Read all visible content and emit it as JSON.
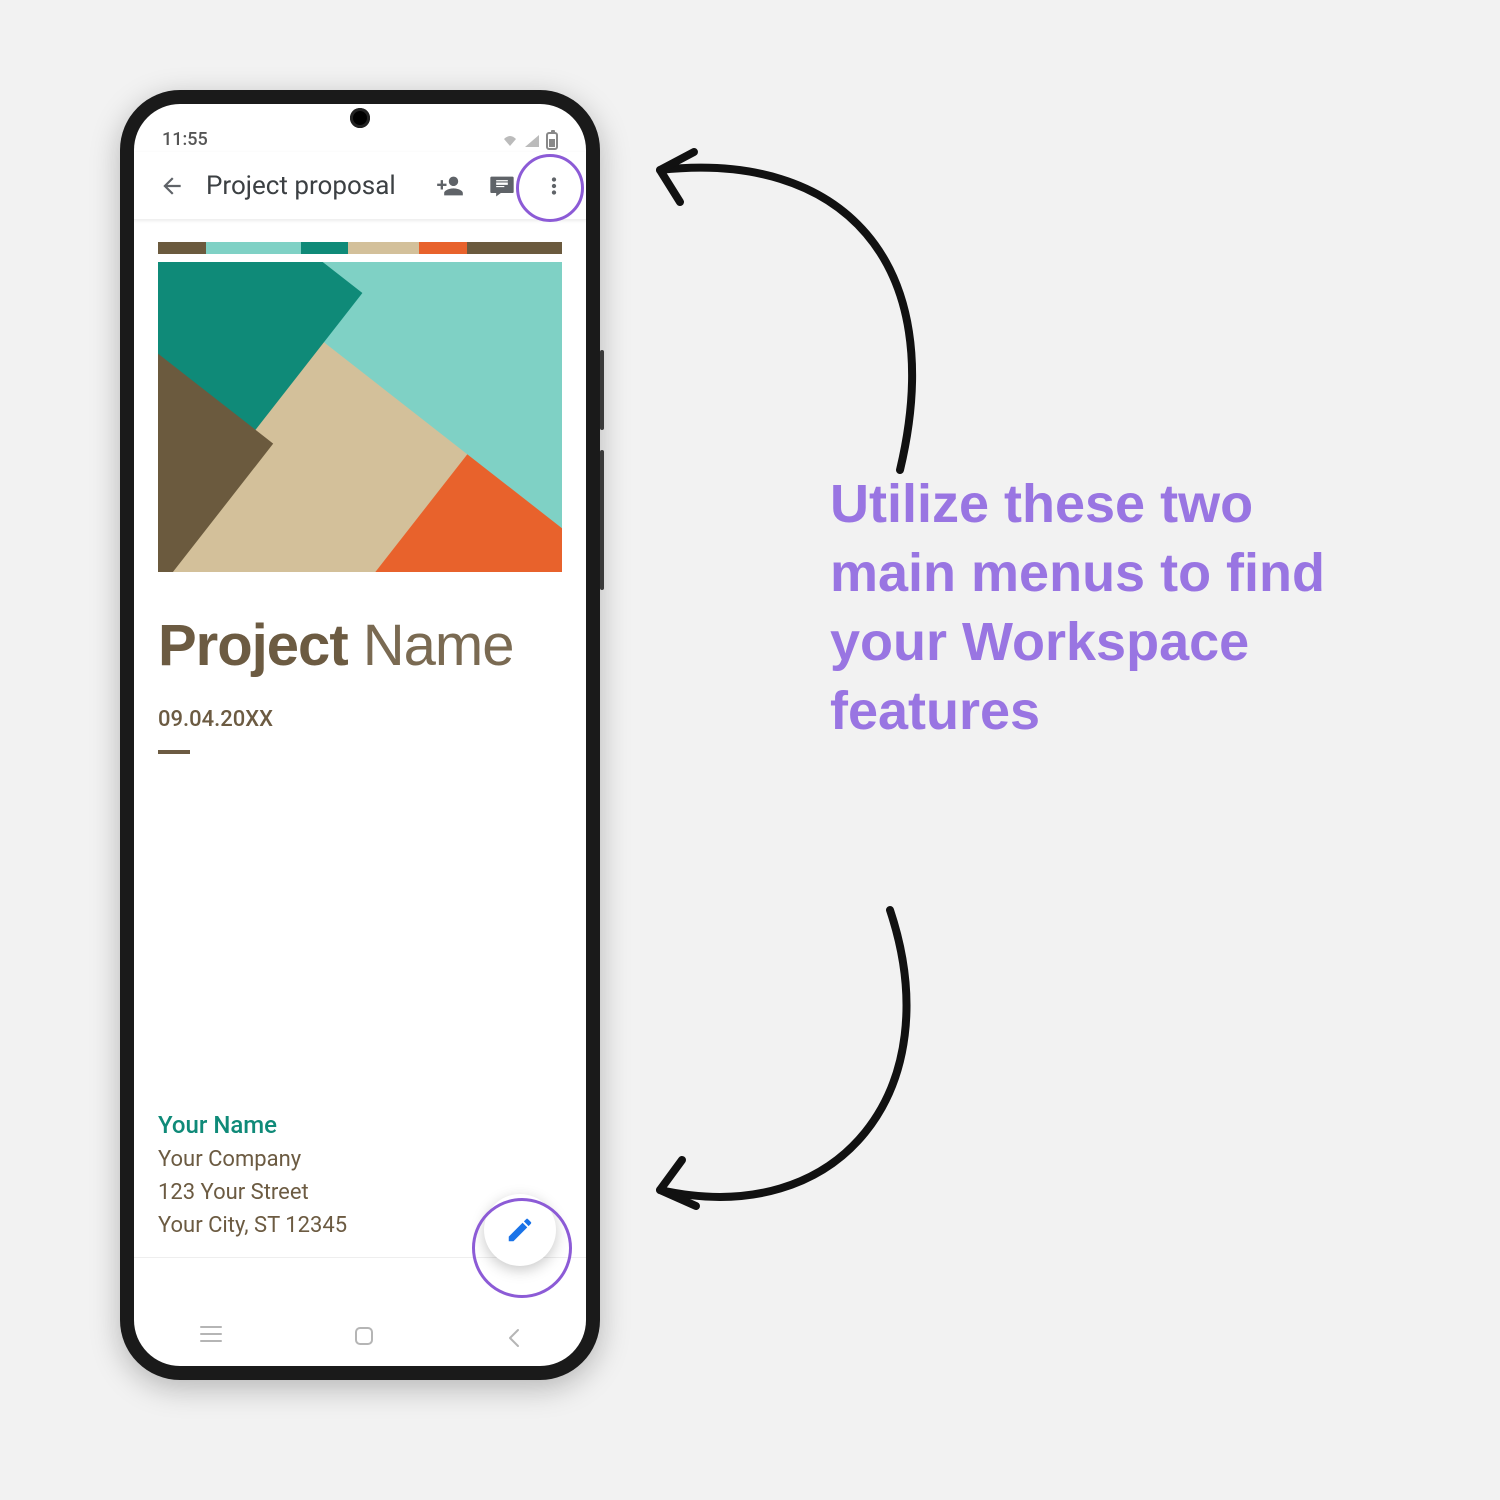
{
  "status_bar": {
    "time": "11:55"
  },
  "toolbar": {
    "title": "Project proposal"
  },
  "document": {
    "title_bold": "Project",
    "title_light": "Name",
    "date": "09.04.20XX",
    "contact": {
      "name": "Your Name",
      "company": "Your Company",
      "street": "123 Your Street",
      "city": "Your City, ST 12345"
    }
  },
  "callout": {
    "text": "Utilize these two main menus to find your Workspace features"
  },
  "colors": {
    "accent_purple": "#8c5bd6",
    "fab_blue": "#1a73e8"
  }
}
